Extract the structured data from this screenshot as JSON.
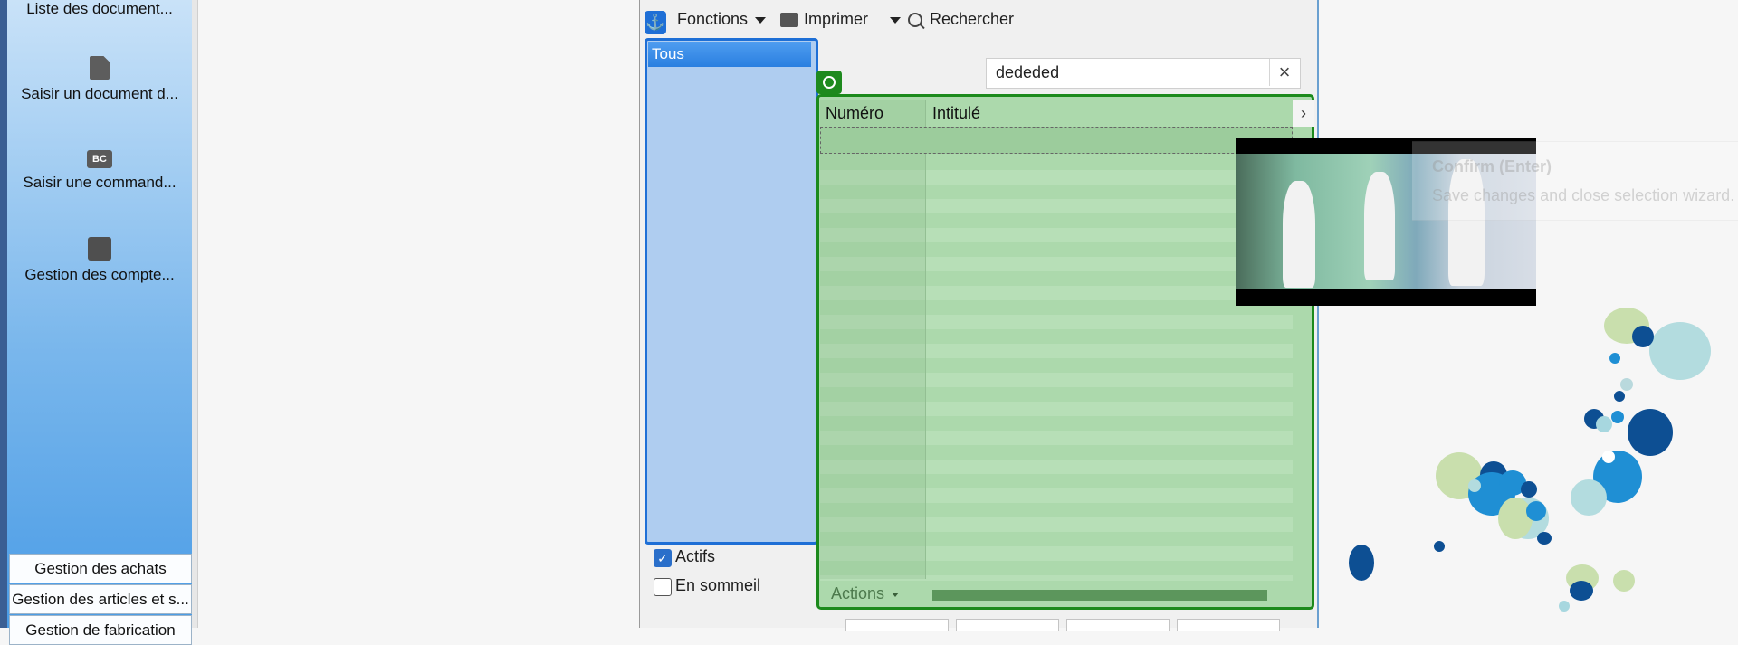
{
  "sidebar": {
    "items": [
      {
        "label": "Liste des document..."
      },
      {
        "label": "Saisir un document d..."
      },
      {
        "label": "Saisir une command...",
        "icon_text": "BC"
      },
      {
        "label": "Gestion des compte..."
      }
    ],
    "modules": [
      {
        "label": "Gestion des achats"
      },
      {
        "label": "Gestion des articles et s..."
      },
      {
        "label": "Gestion de fabrication"
      }
    ]
  },
  "toolbar": {
    "functions_label": "Fonctions",
    "print_label": "Imprimer",
    "search_label": "Rechercher"
  },
  "filter": {
    "selected": "Tous",
    "active_label": "Actifs",
    "active_checked": true,
    "dormant_label": "En sommeil",
    "dormant_checked": false
  },
  "search": {
    "value": "dededed"
  },
  "grid": {
    "columns": [
      "Numéro",
      "Intitulé"
    ],
    "actions_label": "Actions"
  },
  "tooltip": {
    "title": "Confirm (Enter)",
    "body": "Save changes and close selection wizard."
  },
  "colors": {
    "selection_blue": "#1e6fd6",
    "grid_green": "#1c8a1c",
    "grid_fill": "#acd9ac",
    "sidebar_blue": "#4a9ce6"
  }
}
